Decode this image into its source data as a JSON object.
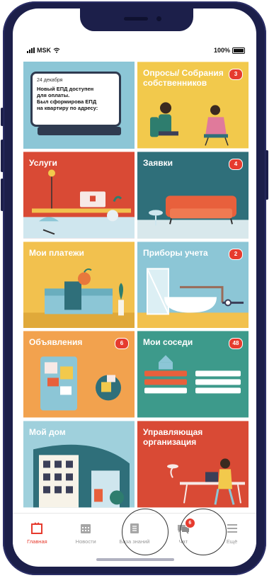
{
  "status_bar": {
    "carrier": "MSK",
    "battery": "100%"
  },
  "news": {
    "date": "24 декабря",
    "text": "Новый ЕПД доступен\nдля оплаты.\nБыл сформирова ЕПД\nна квартиру по адресу:"
  },
  "tiles": [
    {
      "title": "Опросы/ Собрания собственников",
      "badge": "3",
      "bg": "#f2c94c"
    },
    {
      "title": "Услуги",
      "badge": "",
      "bg": "#d94a35"
    },
    {
      "title": "Заявки",
      "badge": "4",
      "bg": "#2f6f7a"
    },
    {
      "title": "Мои платежи",
      "badge": "",
      "bg": "#f2c14e"
    },
    {
      "title": "Приборы учета",
      "badge": "2",
      "bg": "#8cc6d6"
    },
    {
      "title": "Объявления",
      "badge": "6",
      "bg": "#f2a24e"
    },
    {
      "title": "Мои соседи",
      "badge": "48",
      "bg": "#3d9a8b"
    },
    {
      "title": "Мой дом",
      "badge": "",
      "bg": "#9fd0dc"
    },
    {
      "title": "Управляющая организация",
      "badge": "",
      "bg": "#d94a35"
    }
  ],
  "tabbar": {
    "items": [
      {
        "label": "Главная",
        "icon": "home-icon",
        "active": true
      },
      {
        "label": "Новости",
        "icon": "calendar-icon"
      },
      {
        "label": "База знаний",
        "icon": "knowledge-base-icon"
      },
      {
        "label": "Чат",
        "icon": "chat-icon",
        "badge": "6"
      },
      {
        "label": "Ещё",
        "icon": "menu-icon"
      }
    ]
  },
  "colors": {
    "accent": "#e63b2e",
    "frame": "#1c1f4a"
  }
}
